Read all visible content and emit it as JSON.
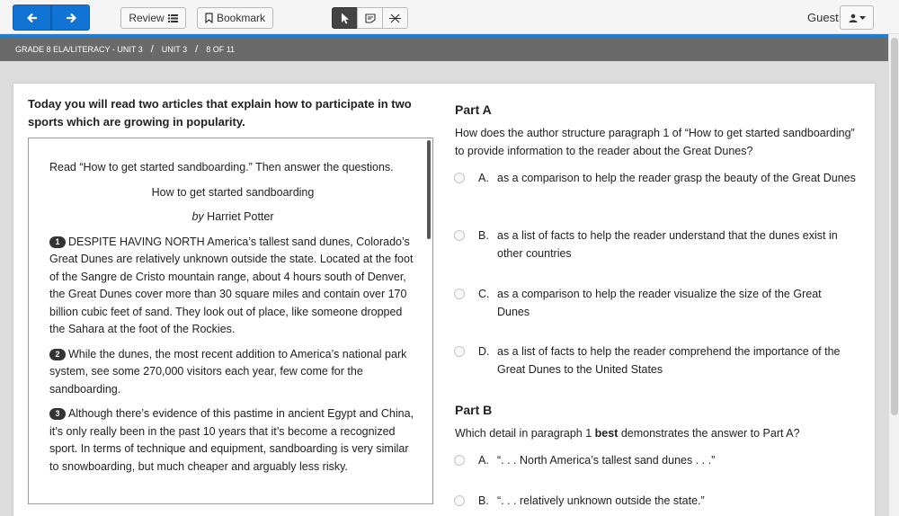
{
  "toolbar": {
    "review_label": "Review",
    "bookmark_label": "Bookmark",
    "user_label": "Guest",
    "nav_back_icon": "arrow-left-icon",
    "nav_next_icon": "arrow-right-icon",
    "accent_color": "#1173d4"
  },
  "breadcrumb": {
    "course": "GRADE 8 ELA/LITERACY - UNIT 3",
    "unit": "UNIT 3",
    "position": "8 OF 11"
  },
  "intro": "Today you will read two articles that explain how to participate in two sports which are growing in popularity.",
  "passage": {
    "instruction": "Read “How to get started sandboarding.” Then answer the questions.",
    "title": "How to get started sandboarding",
    "byline_prefix": "by",
    "author": "Harriet Potter",
    "paragraphs": [
      {
        "num": "1",
        "text": "DESPITE HAVING NORTH America’s tallest sand dunes, Colorado’s Great Dunes are relatively unknown outside the state. Located at the foot of the Sangre de Cristo mountain range, about 4 hours south of Denver, the Great Dunes cover more than 30 square miles and contain over 170 billion cubic feet of sand. They look out of place, like someone dropped the Sahara at the foot of the Rockies."
      },
      {
        "num": "2",
        "text": "While the dunes, the most recent addition to America’s national park system, see some 270,000 visitors each year, few come for the sandboarding."
      },
      {
        "num": "3",
        "text": "Although there’s evidence of this pastime in ancient Egypt and China, it’s only really been in the past 10 years that it’s become a recognized sport. In terms of technique and equipment, sandboarding is very similar to snowboarding, but much cheaper and arguably less risky."
      }
    ]
  },
  "partA": {
    "title": "Part A",
    "stem": "How does the author structure paragraph 1 of “How to get started sandboarding” to provide information to the reader about the Great Dunes?",
    "options": [
      {
        "letter": "A.",
        "text": "as a comparison to help the reader grasp the beauty of the Great Dunes"
      },
      {
        "letter": "B.",
        "text": "as a list of facts to help the reader understand that the dunes exist in other countries"
      },
      {
        "letter": "C.",
        "text": "as a comparison to help the reader visualize the size of the Great Dunes"
      },
      {
        "letter": "D.",
        "text": "as a list of facts to help the reader comprehend the importance of the Great Dunes to the United States"
      }
    ]
  },
  "partB": {
    "title": "Part B",
    "stem_before": "Which detail in paragraph 1 ",
    "stem_bold": "best",
    "stem_after": " demonstrates the answer to Part A?",
    "options": [
      {
        "letter": "A.",
        "text": "“. . . North America’s tallest sand dunes . . .”"
      },
      {
        "letter": "B.",
        "text": "“. . . relatively unknown outside the state.”"
      }
    ]
  }
}
